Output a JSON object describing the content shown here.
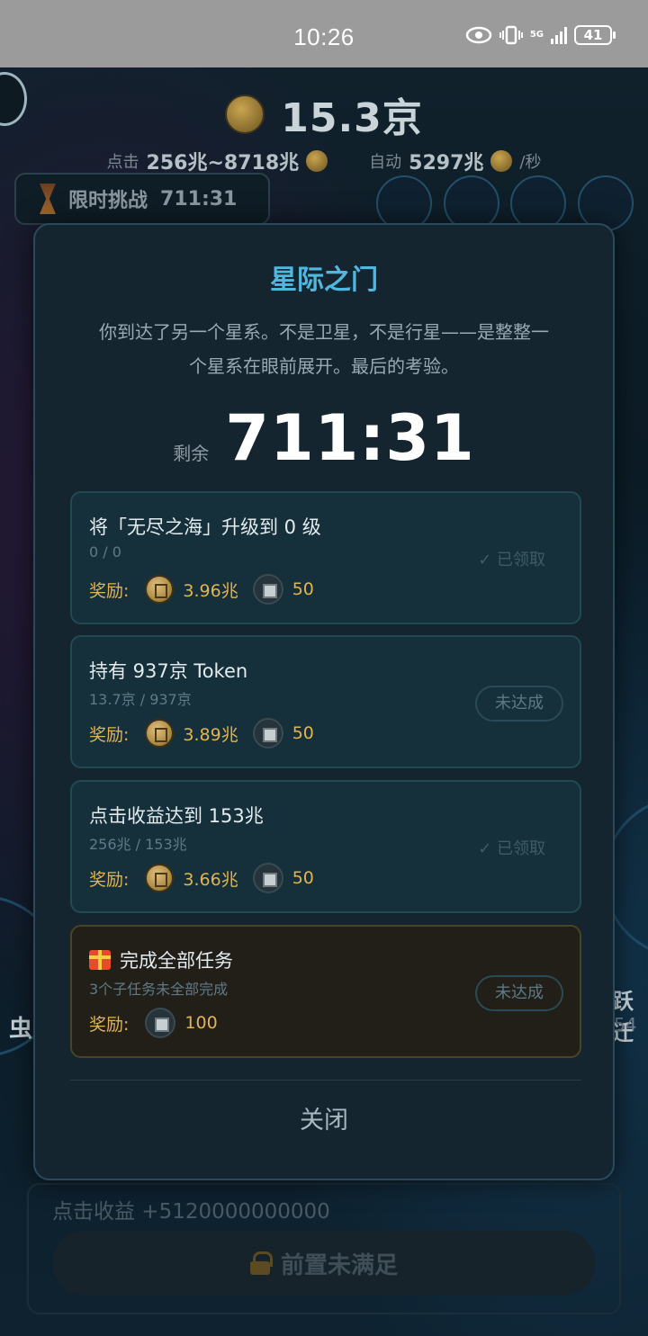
{
  "status_bar": {
    "time": "10:26",
    "network": "5G",
    "battery": "41"
  },
  "game": {
    "balance": "15.3京",
    "click_label": "点击",
    "click_range": "256兆~8718兆",
    "auto_label": "自动",
    "auto_rate": "5297兆",
    "per_second": "/秒",
    "challenge_label": "限时挑战",
    "challenge_timer": "711:31",
    "left_side_label": "虫",
    "right_side_label": "跃迁",
    "right_side_value": "54",
    "click_income": "点击收益 +5120000000000",
    "locked_button": "前置未满足"
  },
  "modal": {
    "title": "星际之门",
    "description_line1": "你到达了另一个星系。不是卫星，不是行星——是整整一",
    "description_line2": "个星系在眼前展开。最后的考验。",
    "remaining_label": "剩余",
    "remaining_value": "711:31",
    "reward_label": "奖励:",
    "tasks": [
      {
        "title": "将「无尽之海」升级到 0 级",
        "progress": "0 / 0",
        "coins": "3.96兆",
        "chips": "50",
        "status": "✓ 已领取"
      },
      {
        "title": "持有 937京 Token",
        "progress": "13.7京 / 937京",
        "coins": "3.89兆",
        "chips": "50",
        "status": "未达成"
      },
      {
        "title": "点击收益达到 153兆",
        "progress": "256兆 / 153兆",
        "coins": "3.66兆",
        "chips": "50",
        "status": "✓ 已领取"
      }
    ],
    "final_task": {
      "title": "完成全部任务",
      "progress": "3个子任务未全部完成",
      "chips": "100",
      "status": "未达成"
    },
    "close_label": "关闭"
  },
  "colors": {
    "accent": "#4fb8e0",
    "reward": "#e2b450",
    "final_border": "#4a4426"
  }
}
